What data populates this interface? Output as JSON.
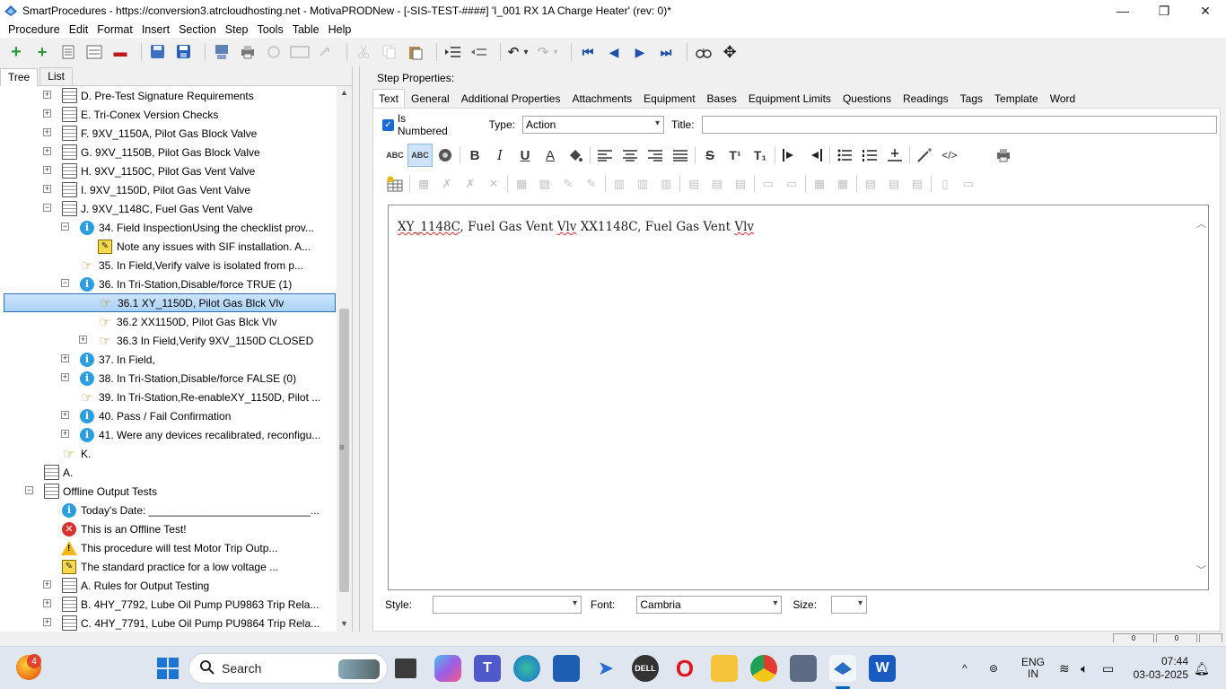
{
  "window": {
    "title": "SmartProcedures - https://conversion3.atrcloudhosting.net - MotivaPRODNew - [-SIS-TEST-####] 'I_001 RX 1A Charge Heater' (rev: 0)*",
    "minimize_glyph": "—",
    "maximize_glyph": "❐",
    "close_glyph": "✕"
  },
  "menu": [
    "Procedure",
    "Edit",
    "Format",
    "Insert",
    "Section",
    "Step",
    "Tools",
    "Table",
    "Help"
  ],
  "toolbar": {
    "icons": [
      "add-icon",
      "add-child-icon",
      "outline-icon",
      "outline2-icon",
      "delete-icon",
      "save-all-icon",
      "save-icon",
      "publish-icon",
      "print-icon",
      "refresh-icon",
      "view-icon",
      "cut-icon",
      "copy-icon",
      "paste-icon",
      "indent-icon",
      "outdent-icon",
      "undo-icon",
      "redo-icon",
      "first-icon",
      "prev-icon",
      "next-icon",
      "last-icon",
      "find-icon",
      "move-icon"
    ],
    "glyphs": {
      "add": "+",
      "add_child": "+",
      "delete": "▬",
      "undo": "↶",
      "redo": "↷",
      "first": "⏮",
      "prev": "◀",
      "next": "▶",
      "last": "⏭",
      "move": "✥",
      "dropdown": "▾"
    }
  },
  "left_tabs": [
    "Tree",
    "List"
  ],
  "tree": [
    {
      "label": "D. Pre-Test Signature Requirements",
      "icon": "doc",
      "level": 2,
      "exp": "+"
    },
    {
      "label": "E. Tri-Conex Version Checks",
      "icon": "doc",
      "level": 2,
      "exp": "+"
    },
    {
      "label": "F. 9XV_1150A, Pilot Gas Block Valve",
      "icon": "doc",
      "level": 2,
      "exp": "+"
    },
    {
      "label": "G. 9XV_1150B, Pilot Gas Block Valve",
      "icon": "doc",
      "level": 2,
      "exp": "+"
    },
    {
      "label": "H. 9XV_1150C, Pilot Gas Vent Valve",
      "icon": "doc",
      "level": 2,
      "exp": "+"
    },
    {
      "label": "I. 9XV_1150D, Pilot Gas Vent Valve",
      "icon": "doc",
      "level": 2,
      "exp": "+"
    },
    {
      "label": "J. 9XV_1148C, Fuel Gas Vent Valve",
      "icon": "doc",
      "level": 2,
      "exp": "−"
    },
    {
      "label": "34. Field InspectionUsing the checklist prov...",
      "icon": "info",
      "level": 3,
      "exp": "−"
    },
    {
      "label": "Note any issues with SIF installation. A...",
      "icon": "note",
      "level": 4,
      "exp": ""
    },
    {
      "label": "35. In Field,Verify valve is isolated from p...",
      "icon": "hand",
      "level": 3,
      "exp": ""
    },
    {
      "label": "36. In Tri-Station,Disable/force TRUE (1)",
      "icon": "info",
      "level": 3,
      "exp": "−"
    },
    {
      "label": "36.1 XY_1150D, Pilot Gas Blck Vlv",
      "icon": "hand",
      "level": 4,
      "exp": "",
      "selected": true
    },
    {
      "label": "36.2 XX1150D, Pilot Gas Blck Vlv",
      "icon": "hand",
      "level": 4,
      "exp": ""
    },
    {
      "label": "36.3 In Field,Verify 9XV_1150D CLOSED",
      "icon": "hand",
      "level": 4,
      "exp": "+"
    },
    {
      "label": "37. In Field,",
      "icon": "info",
      "level": 3,
      "exp": "+"
    },
    {
      "label": "38. In Tri-Station,Disable/force FALSE (0)",
      "icon": "info",
      "level": 3,
      "exp": "+"
    },
    {
      "label": "39. In Tri-Station,Re-enableXY_1150D, Pilot ...",
      "icon": "hand",
      "level": 3,
      "exp": ""
    },
    {
      "label": "40. Pass / Fail Confirmation",
      "icon": "info",
      "level": 3,
      "exp": "+"
    },
    {
      "label": "41. Were any devices recalibrated, reconfigu...",
      "icon": "info",
      "level": 3,
      "exp": "+"
    },
    {
      "label": "K.",
      "icon": "hand",
      "level": 2,
      "exp": ""
    },
    {
      "label": "A.",
      "icon": "doc",
      "level": 1,
      "exp": ""
    },
    {
      "label": "Offline Output Tests",
      "icon": "doc",
      "level": 1,
      "exp": "−"
    },
    {
      "label": "Today's Date: ___________________________...",
      "icon": "info",
      "level": 2,
      "exp": ""
    },
    {
      "label": "This is an Offline Test!",
      "icon": "error",
      "level": 2,
      "exp": ""
    },
    {
      "label": "This procedure will test Motor Trip Outp...",
      "icon": "warn",
      "level": 2,
      "exp": ""
    },
    {
      "label": "The standard practice for a low voltage ...",
      "icon": "note",
      "level": 2,
      "exp": ""
    },
    {
      "label": "A. Rules for Output Testing",
      "icon": "doc",
      "level": 2,
      "exp": "+"
    },
    {
      "label": "B. 4HY_7792, Lube Oil Pump PU9863 Trip Rela...",
      "icon": "doc",
      "level": 2,
      "exp": "+"
    },
    {
      "label": "C. 4HY_7791, Lube Oil Pump PU9864 Trip Rela...",
      "icon": "doc",
      "level": 2,
      "exp": "+"
    }
  ],
  "icon_glyphs": {
    "info": "i",
    "hand": "☞",
    "note": "✎",
    "error": "✕",
    "warn": "!"
  },
  "scroll_glyphs": {
    "up": "▲",
    "down": "▼",
    "grip": "≡"
  },
  "step_properties": {
    "heading": "Step Properties:",
    "tabs": [
      "Text",
      "General",
      "Additional Properties",
      "Attachments",
      "Equipment",
      "Bases",
      "Equipment Limits",
      "Questions",
      "Readings",
      "Tags",
      "Template",
      "Word"
    ],
    "is_numbered_label": "Is Numbered",
    "type_label": "Type:",
    "type_value": "Action",
    "title_label": "Title:",
    "title_value": ""
  },
  "format_toolbar": {
    "bold": "B",
    "italic": "I",
    "underline": "U",
    "font_color": "A",
    "strike": "S",
    "superscript": "T¹",
    "subscript": "T₁",
    "html": "</>",
    "spell1": "ABC",
    "spell2": "ABC"
  },
  "editor": {
    "text_parts": [
      {
        "t": "XY_1148C",
        "spell": true
      },
      {
        "t": ", Fuel Gas Vent ",
        "spell": false
      },
      {
        "t": "Vlv",
        "spell": true
      },
      {
        "t": " XX1148C, Fuel Gas Vent ",
        "spell": false
      },
      {
        "t": "Vlv",
        "spell": true
      }
    ],
    "scroll_up": "︿",
    "scroll_down": "﹀"
  },
  "style_row": {
    "style_label": "Style:",
    "style_value": "",
    "font_label": "Font:",
    "font_value": "Cambria",
    "size_label": "Size:",
    "size_value": ""
  },
  "status_bits": [
    "0",
    "0"
  ],
  "taskbar": {
    "search_label": "Search",
    "badge": "4",
    "lang": "ENG",
    "region": "IN",
    "time": "07:44",
    "date": "03-03-2025"
  }
}
